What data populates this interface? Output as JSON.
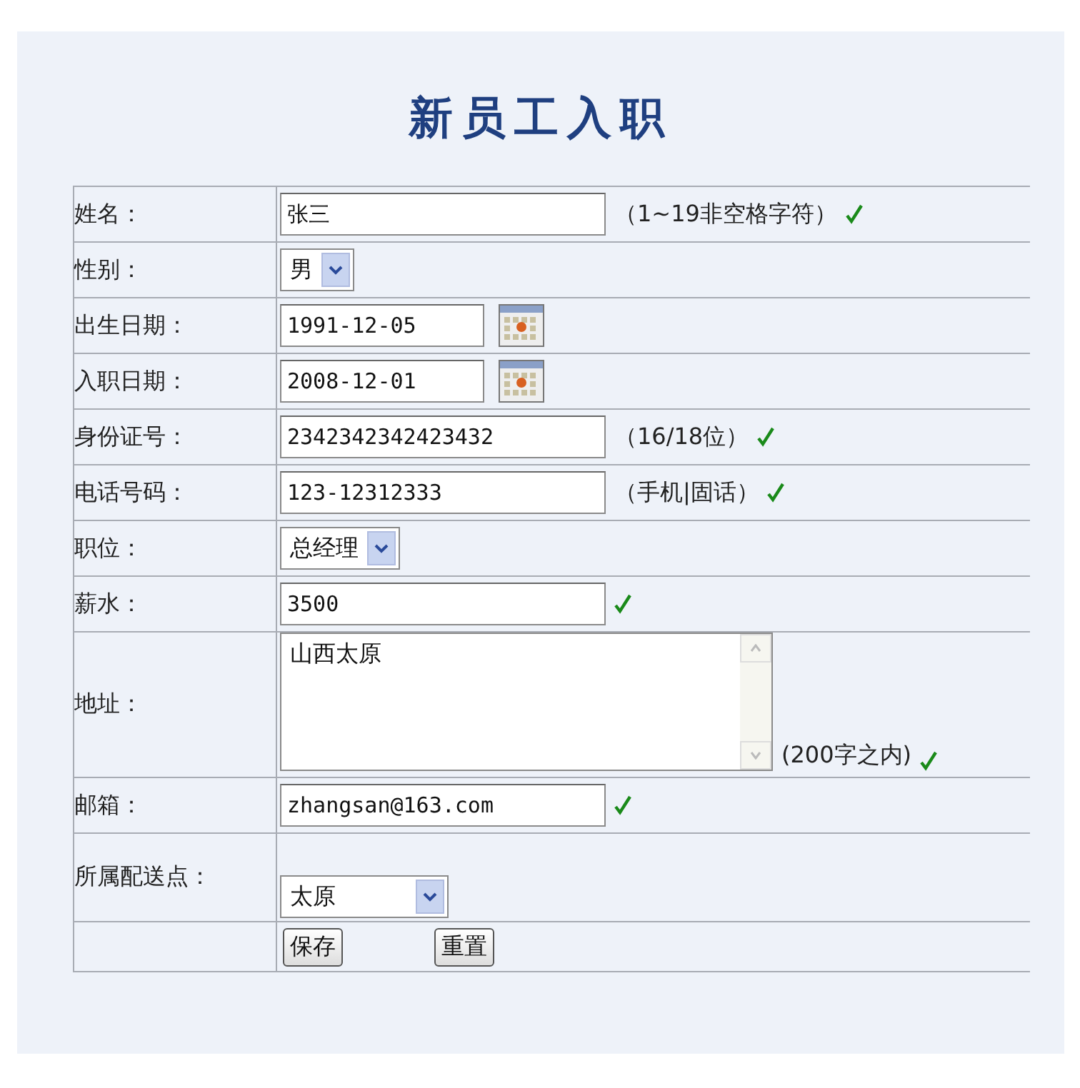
{
  "title": "新员工入职",
  "rows": [
    {
      "kind": "text",
      "label": "姓名：",
      "value": "张三",
      "hint": "（1~19非空格字符）",
      "valid": true
    },
    {
      "kind": "select",
      "label": "性别：",
      "value": "男"
    },
    {
      "kind": "date",
      "label": "出生日期：",
      "value": "1991-12-05"
    },
    {
      "kind": "date",
      "label": "入职日期：",
      "value": "2008-12-01"
    },
    {
      "kind": "text",
      "label": "身份证号：",
      "value": "2342342342423432",
      "hint": "（16/18位）",
      "valid": true
    },
    {
      "kind": "text",
      "label": "电话号码：",
      "value": "123-12312333",
      "hint": "（手机|固话）",
      "valid": true
    },
    {
      "kind": "select",
      "label": "职位：",
      "value": "总经理"
    },
    {
      "kind": "text",
      "label": "薪水：",
      "value": "3500",
      "valid": true
    },
    {
      "kind": "textarea",
      "label": "地址：",
      "value": "山西太原",
      "hint": "(200字之内)",
      "valid": true
    },
    {
      "kind": "text",
      "label": "邮箱：",
      "value": "zhangsan@163.com",
      "valid": true
    },
    {
      "kind": "select-low",
      "label": "所属配送点：",
      "value": "太原"
    }
  ],
  "buttons": [
    "保存",
    "重置"
  ]
}
